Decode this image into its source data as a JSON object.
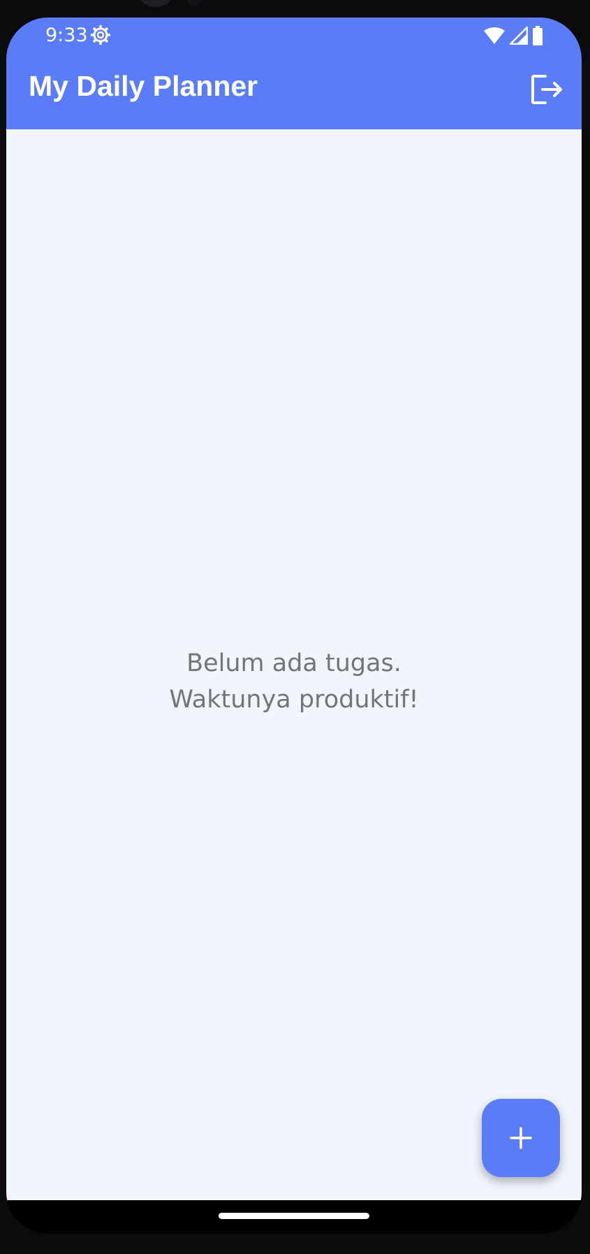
{
  "status_bar": {
    "time": "9:33",
    "icons": [
      "gear-icon",
      "wifi-icon",
      "signal-icon",
      "battery-icon"
    ]
  },
  "app_bar": {
    "title": "My Daily Planner",
    "action_icon": "logout-icon"
  },
  "empty_state": {
    "line1": "Belum ada tugas.",
    "line2": "Waktunya produktif!"
  },
  "fab": {
    "icon": "plus-icon"
  },
  "colors": {
    "primary": "#5b7cf7",
    "background": "#f1f5fc",
    "empty_text": "#757575",
    "on_primary": "#ffffff"
  }
}
